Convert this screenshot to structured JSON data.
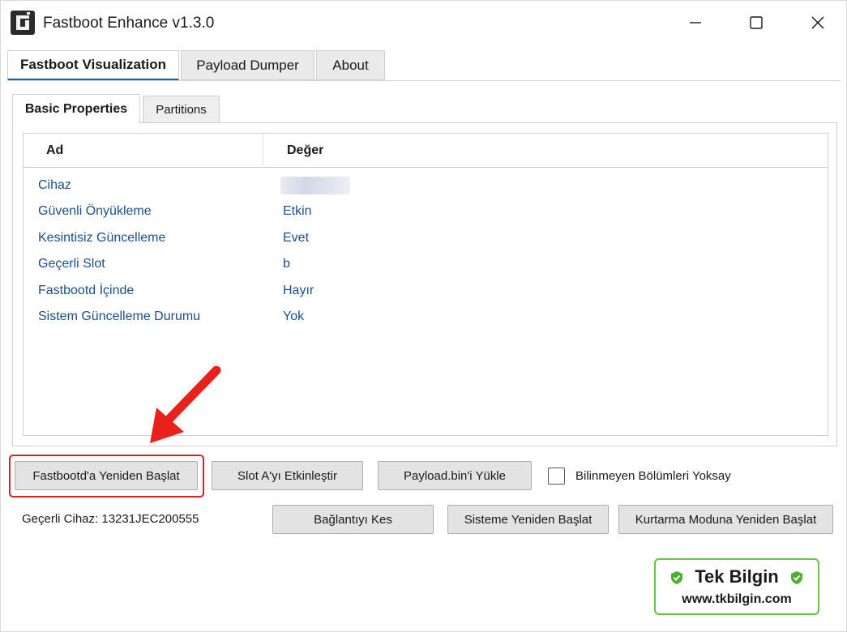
{
  "window": {
    "title": "Fastboot Enhance v1.3.0",
    "icon": "app-fragment-icon",
    "controls": [
      "minimize-icon",
      "maximize-icon",
      "close-icon"
    ]
  },
  "outer_tabs": [
    {
      "label": "Fastboot Visualization",
      "active": true
    },
    {
      "label": "Payload Dumper",
      "active": false
    },
    {
      "label": "About",
      "active": false
    }
  ],
  "inner_tabs": [
    {
      "label": "Basic Properties",
      "active": true
    },
    {
      "label": "Partitions",
      "active": false
    }
  ],
  "properties": {
    "columns": [
      "Ad",
      "Değer"
    ],
    "rows": [
      {
        "name": "Cihaz",
        "value": ""
      },
      {
        "name": "Güvenli Önyükleme",
        "value": "Etkin"
      },
      {
        "name": "Kesintisiz Güncelleme",
        "value": "Evet"
      },
      {
        "name": "Geçerli Slot",
        "value": "b"
      },
      {
        "name": "Fastbootd İçinde",
        "value": "Hayır"
      },
      {
        "name": "Sistem Güncelleme Durumu",
        "value": "Yok"
      }
    ]
  },
  "buttons": {
    "reboot_fastbootd": "Fastbootd'a Yeniden Başlat",
    "activate_slot_a": "Slot A'yı Etkinleştir",
    "load_payload": "Payload.bin'i Yükle",
    "disconnect": "Bağlantıyı Kes",
    "reboot_system": "Sisteme Yeniden Başlat",
    "reboot_recovery": "Kurtarma Moduna Yeniden Başlat"
  },
  "options": {
    "ignore_unknown_partitions_label": "Bilinmeyen Bölümleri Yoksay",
    "ignore_unknown_partitions_checked": false
  },
  "status": {
    "current_device": "Geçerli Cihaz: 13231JEC200555"
  },
  "watermark": {
    "title": "Tek Bilgin",
    "url": "www.tkbilgin.com",
    "icon": "shield-check-icon"
  },
  "colors": {
    "accent": "#0067c0",
    "value_text": "#1a4f8a",
    "highlight": "#e02020",
    "watermark_border": "#6dbf4b"
  }
}
